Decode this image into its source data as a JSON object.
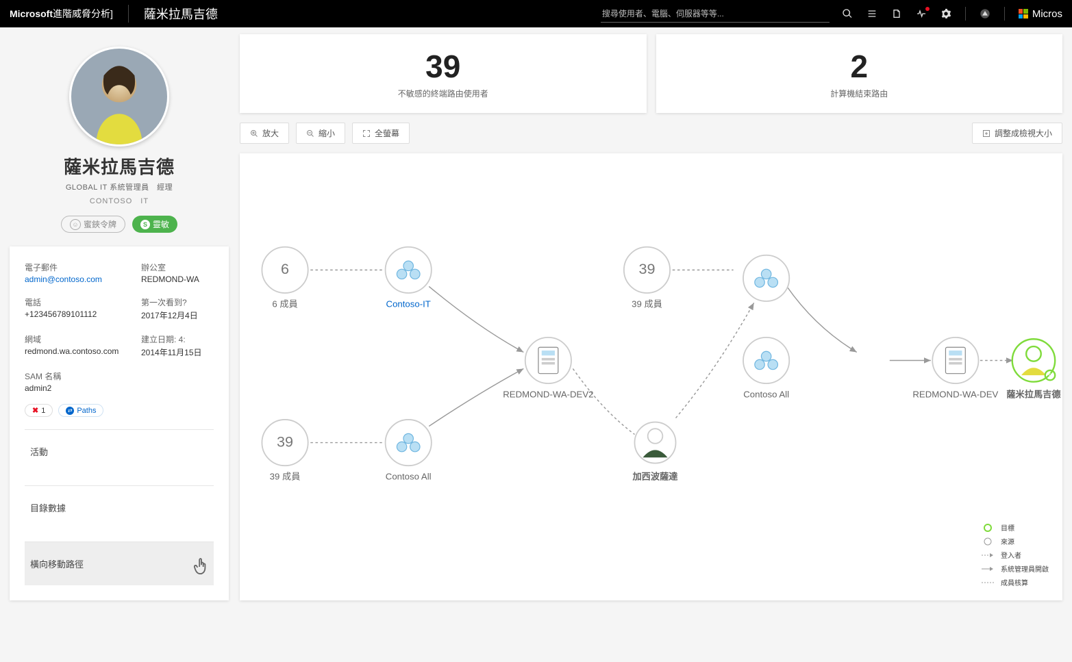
{
  "header": {
    "product_brand": "Microsoft",
    "product_name": "進階威脅分析]",
    "page_title": "薩米拉馬吉德",
    "search_placeholder": "搜尋使用者、電腦、伺服器等等...",
    "account_brand": "Micros"
  },
  "profile": {
    "name": "薩米拉馬吉德",
    "role_line": "GLOBAL IT 系統管理員　經理",
    "org_line": "CONTOSO　IT",
    "badges": {
      "honeytoken": "蜜鋏令牌",
      "sensitive": "靈敏"
    },
    "fields": {
      "email_lbl": "電子郵件",
      "email_val": "admin@contoso.com",
      "office_lbl": "辦公室",
      "office_val": "REDMOND-WA",
      "phone_lbl": "電話",
      "phone_val": "+123456789101112",
      "firstseen_lbl": "第一次看到?",
      "firstseen_val": "2017年12月4日",
      "domain_lbl": "網域",
      "domain_val": "redmond.wa.contoso.com",
      "created_lbl": "建立日期: 4:",
      "created_val": "2014年11月15日",
      "sam_lbl": "SAM 名稱",
      "sam_val": "admin2"
    },
    "alert_count": "1",
    "paths_chip": "Paths",
    "nav": {
      "activity": "活動",
      "directory": "目錄數據",
      "lmp": "橫向移動路徑"
    }
  },
  "kpis": [
    {
      "value": "39",
      "label": "不敏感的終端路由使用者"
    },
    {
      "value": "2",
      "label": "計算機結束路由"
    }
  ],
  "toolbar": {
    "zoom_in": "放大",
    "zoom_out": "縮小",
    "fullscreen": "全螢幕",
    "fit": "調整成檢視大小"
  },
  "graph": {
    "nodes": {
      "n6": {
        "count": "6",
        "label_prefix": "6",
        "label_suffix": " 成員"
      },
      "n39a": {
        "count": "39",
        "label_prefix": "39",
        "label_suffix": " 成員"
      },
      "contosoIT": {
        "label": "Contoso-IT"
      },
      "contosoAll1": {
        "label": "Contoso All"
      },
      "n39b": {
        "count": "39",
        "label_prefix": "39",
        "label_suffix": " 成員"
      },
      "srv1": {
        "label": "REDMOND-WA-DEV2"
      },
      "user1": {
        "label": "加西波薩達"
      },
      "contosoAll2": {
        "label": "Contoso All"
      },
      "srv2": {
        "label": "REDMOND-WA-DEV"
      },
      "target": {
        "label": "薩米拉馬吉德"
      }
    },
    "legend": {
      "target": "目標",
      "source": "來源",
      "logged": "登入者",
      "admin": "系統管理員開啟",
      "member": "成員核算"
    }
  }
}
